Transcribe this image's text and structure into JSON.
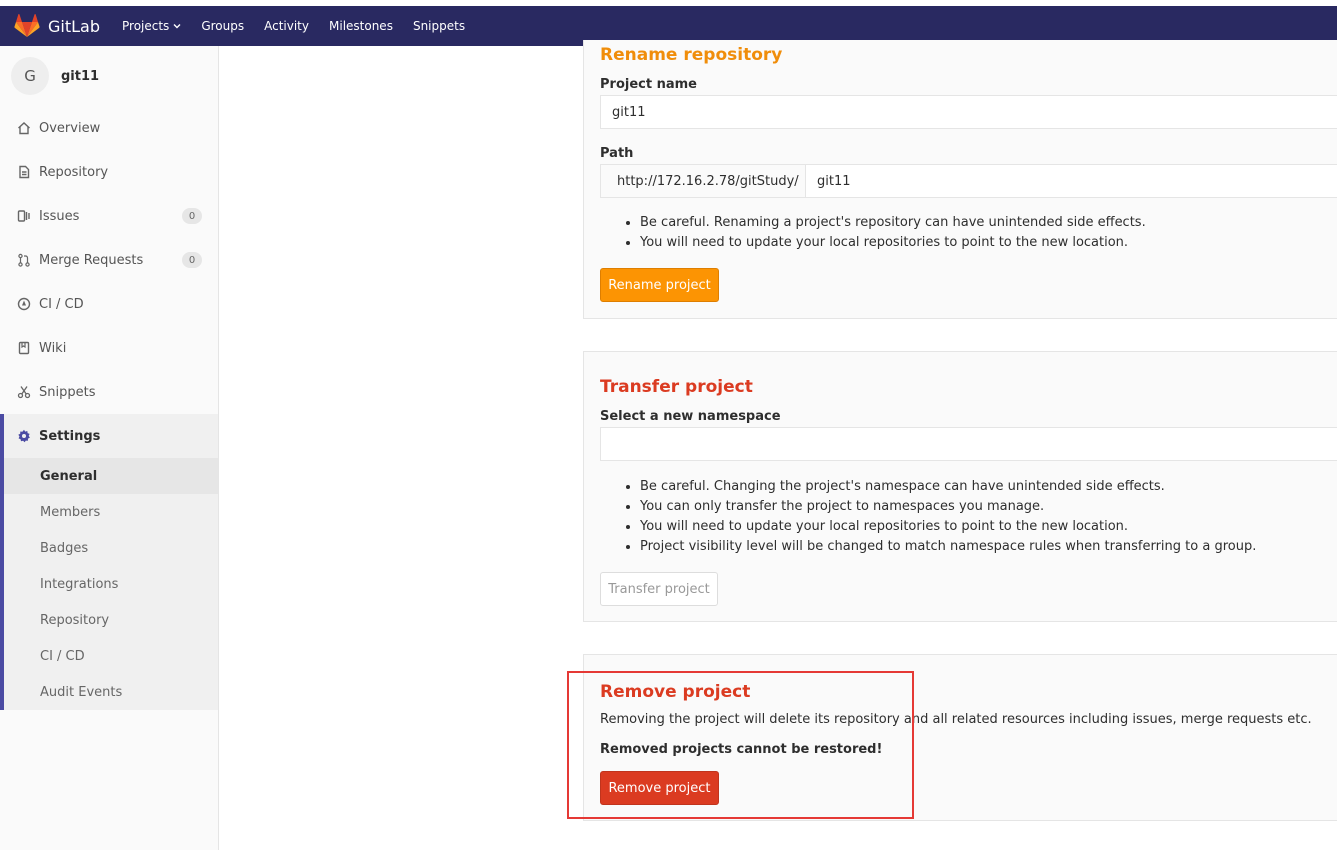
{
  "header": {
    "brand": "GitLab",
    "nav": [
      {
        "label": "Projects",
        "dropdown": true
      },
      {
        "label": "Groups"
      },
      {
        "label": "Activity"
      },
      {
        "label": "Milestones"
      },
      {
        "label": "Snippets"
      }
    ],
    "bg_color": "#292961"
  },
  "sidebar": {
    "project_initial": "G",
    "project_name": "git11",
    "items": [
      {
        "label": "Overview",
        "icon": "home-icon"
      },
      {
        "label": "Repository",
        "icon": "doc-icon"
      },
      {
        "label": "Issues",
        "icon": "issues-icon",
        "badge": "0"
      },
      {
        "label": "Merge Requests",
        "icon": "merge-icon",
        "badge": "0"
      },
      {
        "label": "CI / CD",
        "icon": "rocket-icon"
      },
      {
        "label": "Wiki",
        "icon": "book-icon"
      },
      {
        "label": "Snippets",
        "icon": "scissors-icon"
      }
    ],
    "settings": {
      "label": "Settings",
      "icon": "gear-icon",
      "subitems": [
        "General",
        "Members",
        "Badges",
        "Integrations",
        "Repository",
        "CI / CD",
        "Audit Events"
      ],
      "active": "General"
    }
  },
  "rename": {
    "title": "Rename repository",
    "project_name_label": "Project name",
    "project_name_value": "git11",
    "path_label": "Path",
    "path_prefix": "http://172.16.2.78/gitStudy/",
    "path_value": "git11",
    "notes": [
      "Be careful. Renaming a project's repository can have unintended side effects.",
      "You will need to update your local repositories to point to the new location."
    ],
    "button": "Rename project"
  },
  "transfer": {
    "title": "Transfer project",
    "namespace_label": "Select a new namespace",
    "namespace_value": "",
    "notes": [
      "Be careful. Changing the project's namespace can have unintended side effects.",
      "You can only transfer the project to namespaces you manage.",
      "You will need to update your local repositories to point to the new location.",
      "Project visibility level will be changed to match namespace rules when transferring to a group."
    ],
    "button": "Transfer project"
  },
  "remove": {
    "title": "Remove project",
    "description": "Removing the project will delete its repository and all related resources including issues, merge requests etc.",
    "warning": "Removed projects cannot be restored!",
    "button": "Remove project"
  },
  "colors": {
    "accent_orange": "#fc9403",
    "danger_red": "#db3b21",
    "highlight": "#e53935"
  }
}
